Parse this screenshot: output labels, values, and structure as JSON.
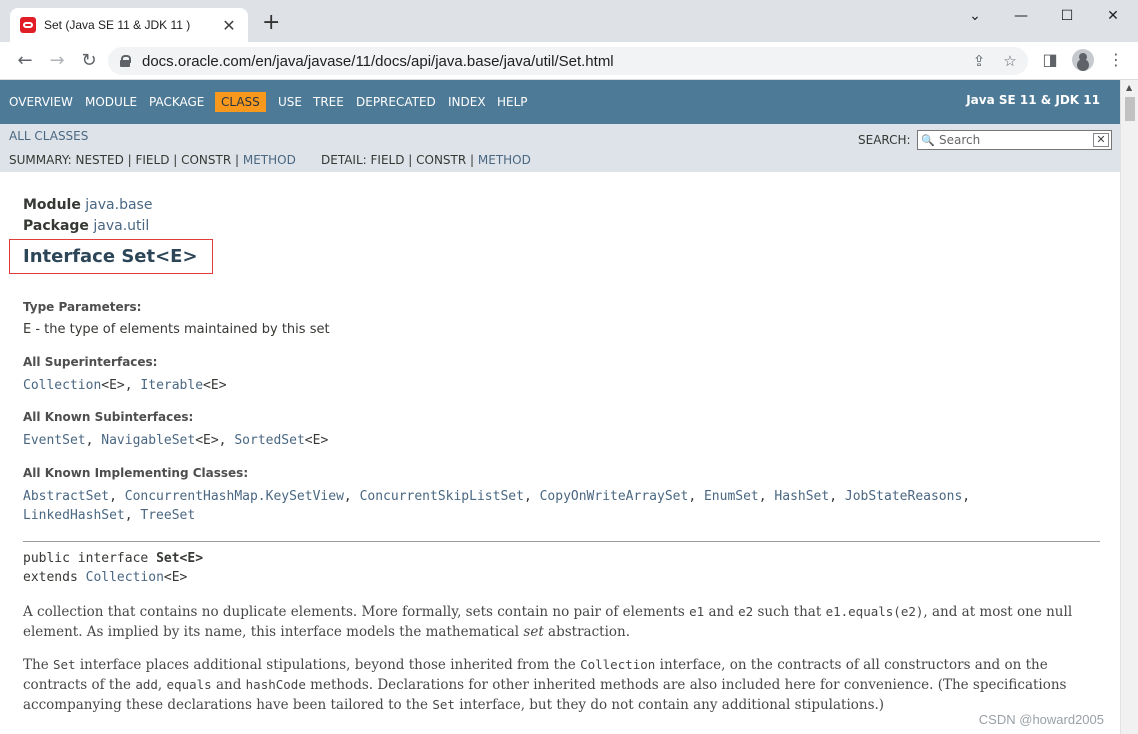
{
  "browser": {
    "tab_title": "Set (Java SE 11 & JDK 11 )",
    "tab_close": "✕",
    "new_tab": "+",
    "url": "docs.oracle.com/en/java/javase/11/docs/api/java.base/java/util/Set.html",
    "icons": [
      "back-icon",
      "forward-icon",
      "reload-icon",
      "lock-icon",
      "share-icon",
      "star-icon",
      "sidepanel-icon",
      "profile-icon",
      "menu-icon"
    ]
  },
  "navbar": {
    "items": [
      "OVERVIEW",
      "MODULE",
      "PACKAGE",
      "CLASS",
      "USE",
      "TREE",
      "DEPRECATED",
      "INDEX",
      "HELP"
    ],
    "active": "CLASS",
    "brand": "Java SE 11 & JDK 11",
    "active_color": "#f8981d",
    "bar_color": "#4d7a97"
  },
  "subnav": {
    "all_classes": "ALL CLASSES",
    "summary_prefix": "SUMMARY: NESTED | FIELD | CONSTR | ",
    "summary_method": "METHOD",
    "detail_prefix": "DETAIL: FIELD | CONSTR | ",
    "detail_method": "METHOD",
    "search_label": "SEARCH:",
    "search_placeholder": "Search"
  },
  "header": {
    "module_label": "Module",
    "module_value": "java.base",
    "package_label": "Package",
    "package_value": "java.util",
    "title": "Interface Set<E>"
  },
  "details": {
    "type_params_label": "Type Parameters:",
    "type_params_value": "E - the type of elements maintained by this set",
    "superinterfaces_label": "All Superinterfaces:",
    "superinterfaces": [
      {
        "name": "Collection",
        "suffix": "<E>, "
      },
      {
        "name": "Iterable",
        "suffix": "<E>"
      }
    ],
    "subinterfaces_label": "All Known Subinterfaces:",
    "subinterfaces": [
      {
        "name": "EventSet",
        "suffix": ", "
      },
      {
        "name": "NavigableSet",
        "suffix": "<E>, "
      },
      {
        "name": "SortedSet",
        "suffix": "<E>"
      }
    ],
    "implementing_label": "All Known Implementing Classes:",
    "implementing_line1": [
      {
        "name": "AbstractSet",
        "suffix": ", "
      },
      {
        "name": "ConcurrentHashMap.KeySetView",
        "suffix": ", "
      },
      {
        "name": "ConcurrentSkipListSet",
        "suffix": ", "
      },
      {
        "name": "CopyOnWriteArraySet",
        "suffix": ", "
      },
      {
        "name": "EnumSet",
        "suffix": ", "
      },
      {
        "name": "HashSet",
        "suffix": ", "
      },
      {
        "name": "JobStateReasons",
        "suffix": ","
      }
    ],
    "implementing_line2": [
      {
        "name": "LinkedHashSet",
        "suffix": ", "
      },
      {
        "name": "TreeSet",
        "suffix": ""
      }
    ]
  },
  "signature": {
    "line1_prefix": "public interface ",
    "line1_name": "Set<E>",
    "line2_prefix": "extends ",
    "line2_link": "Collection",
    "line2_suffix": "<E>"
  },
  "description": {
    "p1_a": "A collection that contains no duplicate elements. More formally, sets contain no pair of elements ",
    "p1_code1": "e1",
    "p1_b": " and ",
    "p1_code2": "e2",
    "p1_c": " such that ",
    "p1_code3": "e1.equals(e2)",
    "p1_d": ", and at most one null element. As implied by its name, this interface models the mathematical ",
    "p1_em": "set",
    "p1_e": " abstraction.",
    "p2_a": "The ",
    "p2_code1": "Set",
    "p2_b": " interface places additional stipulations, beyond those inherited from the ",
    "p2_code2": "Collection",
    "p2_c": " interface, on the contracts of all constructors and on the contracts of the ",
    "p2_code3": "add",
    "p2_d": ", ",
    "p2_code4": "equals",
    "p2_e": " and ",
    "p2_code5": "hashCode",
    "p2_f": " methods. Declarations for other inherited methods are also included here for convenience. (The specifications accompanying these declarations have been tailored to the ",
    "p2_code6": "Set",
    "p2_g": " interface, but they do not contain any additional stipulations.)"
  },
  "watermark": "CSDN @howard2005"
}
